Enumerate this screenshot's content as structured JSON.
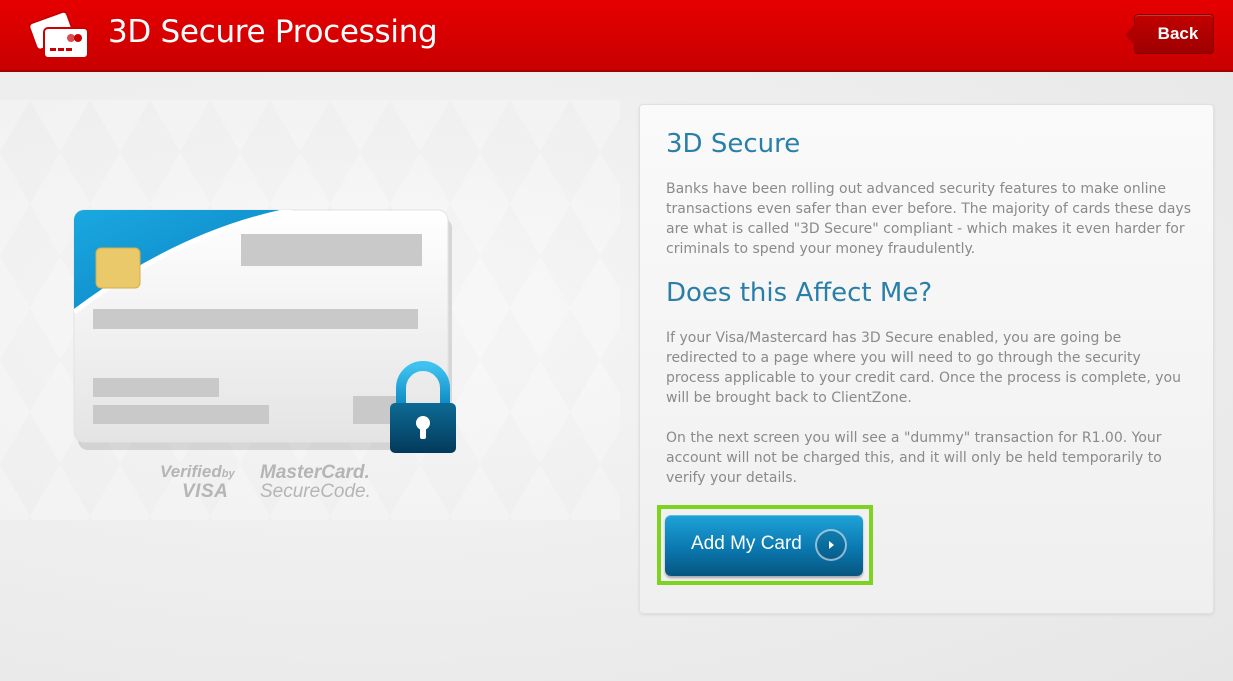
{
  "header": {
    "title": "3D Secure Processing",
    "back_label": "Back",
    "icon": "credit-cards-icon"
  },
  "illustration": {
    "logos": {
      "verified_line1": "Verified",
      "verified_by": "by",
      "verified_line2": "VISA",
      "mastercard_line1": "MasterCard.",
      "mastercard_line2": "SecureCode."
    }
  },
  "panel": {
    "heading_1": "3D Secure",
    "paragraph_1": "Banks have been rolling out advanced security features to make online transactions even safer than ever before. The majority of cards these days are what is called \"3D Secure\" compliant - which makes it even harder for criminals to spend your money fraudulently.",
    "heading_2": "Does this Affect Me?",
    "paragraph_2": "If your Visa/Mastercard has 3D Secure enabled, you are going be redirected to a page where you will need to go through the security process applicable to your credit card. Once the process is complete, you will be brought back to ClientZone.",
    "paragraph_3": "On the next screen you will see a \"dummy\" transaction for R1.00. Your account will not be charged this, and it will only be held temporarily to verify your details.",
    "add_card_label": "Add My Card"
  },
  "colors": {
    "header_red": "#d40000",
    "heading_blue": "#2a7fa8",
    "button_blue": "#0a78b0",
    "highlight_green": "#7ed321"
  }
}
